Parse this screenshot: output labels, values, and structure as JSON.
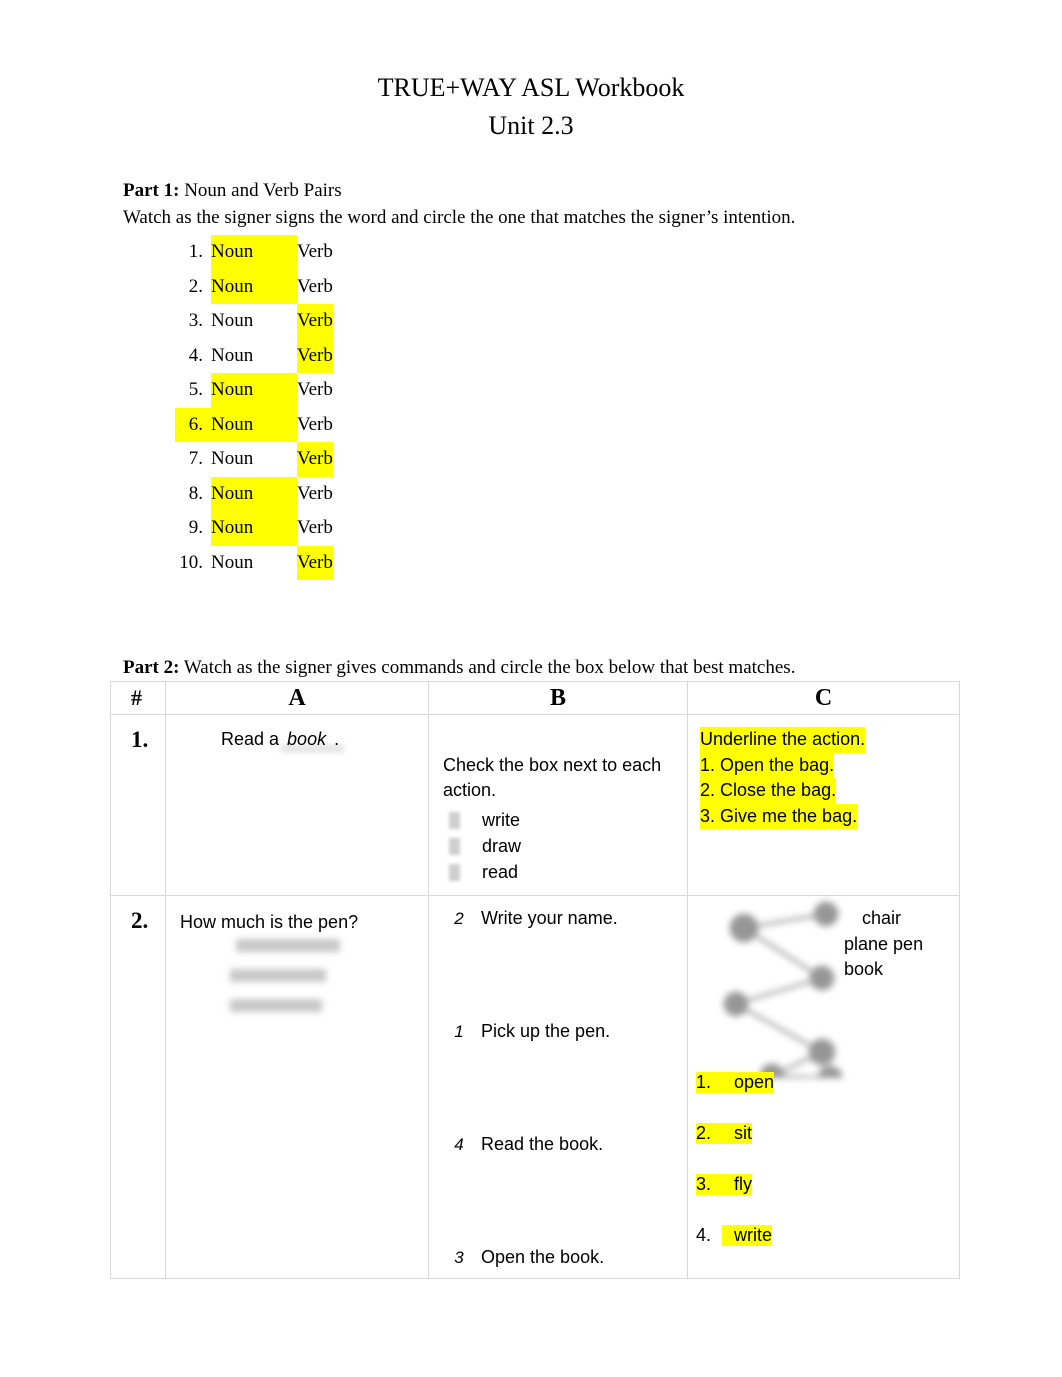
{
  "document": {
    "title": "TRUE+WAY ASL Workbook",
    "subtitle": "Unit 2.3"
  },
  "colors": {
    "highlight": "#ffff00",
    "text": "#000000",
    "table_border": "#d9d9d9",
    "ghost": "#b9b9b9"
  },
  "part1": {
    "label": "Part 1:",
    "heading": "Noun and Verb Pairs",
    "instruction": "Watch as the signer signs the word and circle the one that matches the signer’s intention.",
    "noun_label": "Noun",
    "verb_label": "Verb",
    "items": [
      {
        "num": "1.",
        "noun": "Noun",
        "verb": "Verb",
        "selected": "noun"
      },
      {
        "num": "2.",
        "noun": "Noun",
        "verb": "Verb",
        "selected": "noun"
      },
      {
        "num": "3.",
        "noun": "Noun",
        "verb": "Verb",
        "selected": "verb"
      },
      {
        "num": "4.",
        "noun": "Noun",
        "verb": "Verb",
        "selected": "verb"
      },
      {
        "num": "5.",
        "noun": "Noun",
        "verb": "Verb",
        "selected": "noun"
      },
      {
        "num": "6.",
        "noun": "Noun",
        "verb": "Verb",
        "selected": "noun"
      },
      {
        "num": "7.",
        "noun": "Noun",
        "verb": "Verb",
        "selected": "verb"
      },
      {
        "num": "8.",
        "noun": "Noun",
        "verb": "Verb",
        "selected": "noun"
      },
      {
        "num": "9.",
        "noun": "Noun",
        "verb": "Verb",
        "selected": "noun"
      },
      {
        "num": "10.",
        "noun": "Noun",
        "verb": "Verb",
        "selected": "verb"
      }
    ]
  },
  "part2": {
    "label": "Part 2:",
    "instruction": "Watch as the signer gives commands and circle the box below that best matches.",
    "headers": {
      "num": "#",
      "a": "A",
      "b": "B",
      "c": "C"
    },
    "rows": [
      {
        "num": "1.",
        "a": {
          "prefix": "Read a",
          "blank_word": "book",
          "suffix": "."
        },
        "b": {
          "prompt": "Check the box next to each action.",
          "options": [
            "write",
            "draw",
            "read"
          ]
        },
        "c": {
          "highlighted": true,
          "lines": [
            "Underline the action.",
            "1. Open the bag.",
            "2. Close the bag.",
            "3. Give me the bag."
          ]
        }
      },
      {
        "num": "2.",
        "a": {
          "question": "How much is the pen?",
          "faded_note": "(faded, illegible answer choices)"
        },
        "b": {
          "items": [
            {
              "order": "2",
              "text": "Write your name."
            },
            {
              "order": "1",
              "text": "Pick up the pen."
            },
            {
              "order": "4",
              "text": "Read the book."
            },
            {
              "order": "3",
              "text": "Open the book."
            }
          ]
        },
        "c": {
          "matching_words": [
            "chair",
            "plane pen",
            "book"
          ],
          "list": [
            {
              "num": "1.",
              "word": "open",
              "highlight": "all"
            },
            {
              "num": "2.",
              "word": "sit",
              "highlight": "all"
            },
            {
              "num": "3.",
              "word": "fly",
              "highlight": "all"
            },
            {
              "num": "4.",
              "word": "write",
              "highlight": "word"
            }
          ]
        }
      }
    ]
  }
}
